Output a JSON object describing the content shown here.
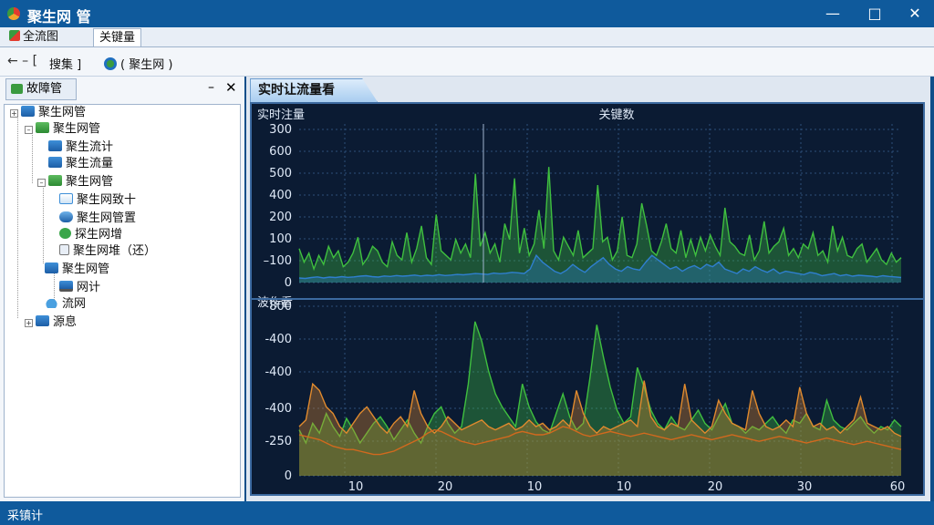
{
  "window": {
    "title": "聚生网 管"
  },
  "menu": {
    "tabs": [
      "全流图",
      "关键量"
    ]
  },
  "toolbar": {
    "back_label": "← – [",
    "breadcrumb_1": "搜集 ]",
    "breadcrumb_2": "( 聚生网 )"
  },
  "left_panel": {
    "header_button": "故障管",
    "pin": "–",
    "close": "✕",
    "tree": [
      {
        "label": "聚生网管",
        "icon": "folder-icon",
        "expander": "+"
      },
      {
        "label": "聚生网管",
        "icon": "green-folder-icon",
        "expander": "–"
      },
      {
        "label": "聚生流计",
        "icon": "folder-icon"
      },
      {
        "label": "聚生流量",
        "icon": "folder-icon"
      },
      {
        "label": "聚生网管",
        "icon": "green-folder-icon",
        "expander": "–"
      },
      {
        "label": "聚生网致十",
        "icon": "document-icon"
      },
      {
        "label": "聚生网管置",
        "icon": "database-icon"
      },
      {
        "label": "探生网增",
        "icon": "check-icon"
      },
      {
        "label": "聚生网堆（还）",
        "icon": "lock-icon"
      },
      {
        "label": "聚生网管",
        "icon": "folder-icon"
      },
      {
        "label": "网计",
        "icon": "monitor-icon"
      },
      {
        "label": "流网",
        "icon": "drop-icon"
      },
      {
        "label": "源息",
        "icon": "folder-icon",
        "expander": "+"
      }
    ]
  },
  "right_panel": {
    "tab_label": "实时让流量看"
  },
  "chart_data": [
    {
      "type": "area",
      "title": "实时注量",
      "subtitle": "关键数",
      "yticks": [
        0,
        100,
        200,
        300,
        400,
        500,
        600,
        300
      ],
      "ytick_labels": [
        "0",
        "–100",
        "100",
        "200",
        "400",
        "500",
        "600",
        "300"
      ],
      "ylim": [
        0,
        700
      ],
      "xlim": [
        5,
        60
      ],
      "series": [
        {
          "color": "#3fbf3f",
          "values": [
            150,
            90,
            130,
            60,
            120,
            80,
            160,
            110,
            140,
            70,
            90,
            130,
            200,
            80,
            110,
            160,
            140,
            90,
            70,
            180,
            120,
            100,
            220,
            90,
            150,
            250,
            110,
            80,
            300,
            140,
            120,
            100,
            190,
            130,
            170,
            110,
            480,
            160,
            220,
            130,
            170,
            90,
            260,
            190,
            460,
            130,
            240,
            120,
            170,
            320,
            150,
            510,
            140,
            100,
            200,
            160,
            120,
            230,
            110,
            130,
            150,
            430,
            180,
            200,
            100,
            140,
            290,
            120,
            110,
            170,
            350,
            250,
            140,
            120,
            180,
            260,
            150,
            130,
            230,
            110,
            190,
            120,
            200,
            140,
            210,
            160,
            120,
            330,
            180,
            160,
            130,
            120,
            210,
            100,
            140,
            270,
            130,
            160,
            180,
            240,
            120,
            150,
            110,
            170,
            150,
            220,
            120,
            140,
            90,
            250,
            140,
            200,
            120,
            110,
            150,
            170,
            90,
            120,
            150,
            100,
            80,
            130,
            90,
            110
          ]
        },
        {
          "color": "#2f7fcf",
          "values": [
            20,
            18,
            22,
            25,
            20,
            24,
            22,
            26,
            23,
            25,
            28,
            30,
            26,
            24,
            29,
            27,
            31,
            28,
            30,
            33,
            29,
            32,
            30,
            35,
            31,
            33,
            36,
            34,
            37,
            40,
            38,
            36,
            42,
            39,
            41,
            45,
            43,
            40,
            60,
            120,
            90,
            70,
            50,
            40,
            55,
            80,
            60,
            45,
            70,
            90,
            110,
            80,
            60,
            50,
            70,
            60,
            55,
            90,
            120,
            100,
            80,
            60,
            70,
            50,
            65,
            75,
            60,
            80,
            70,
            90,
            60,
            50,
            40,
            60,
            50,
            70,
            55,
            45,
            60,
            40,
            50,
            45,
            40,
            35,
            45,
            40,
            30,
            35,
            40,
            30,
            35,
            28,
            32,
            30,
            28,
            25,
            30,
            27,
            25,
            22
          ]
        }
      ]
    },
    {
      "type": "area",
      "title": "波作看",
      "yticks": [
        0,
        250,
        400,
        400,
        400,
        800
      ],
      "ytick_labels": [
        "0",
        "-250",
        "-400",
        "-400",
        "-400",
        "800"
      ],
      "ylim": [
        0,
        1000
      ],
      "xticks": [
        10,
        20,
        10,
        10,
        20,
        30,
        60
      ],
      "xlim": [
        5,
        60
      ],
      "series": [
        {
          "color": "#3fbf3f",
          "values": [
            280,
            200,
            320,
            260,
            380,
            300,
            240,
            350,
            280,
            200,
            260,
            320,
            360,
            300,
            220,
            280,
            340,
            260,
            200,
            300,
            380,
            420,
            320,
            260,
            300,
            560,
            940,
            820,
            640,
            500,
            420,
            360,
            300,
            560,
            420,
            330,
            280,
            260,
            380,
            500,
            360,
            280,
            320,
            600,
            920,
            720,
            540,
            400,
            320,
            360,
            660,
            540,
            400,
            320,
            280,
            360,
            300,
            280,
            340,
            400,
            320,
            280,
            360,
            440,
            320,
            300,
            260,
            300,
            280,
            320,
            360,
            300,
            260,
            340,
            320,
            380,
            300,
            280,
            460,
            340,
            300,
            280,
            320,
            360,
            300,
            260,
            300,
            280,
            340,
            300
          ]
        },
        {
          "color": "#e08a2e",
          "values": [
            300,
            340,
            560,
            520,
            420,
            380,
            300,
            260,
            320,
            380,
            420,
            360,
            300,
            260,
            320,
            360,
            300,
            520,
            380,
            300,
            260,
            300,
            360,
            320,
            280,
            300,
            320,
            340,
            300,
            280,
            300,
            320,
            280,
            300,
            340,
            300,
            320,
            280,
            300,
            340,
            300,
            520,
            380,
            300,
            260,
            300,
            280,
            300,
            320,
            340,
            300,
            580,
            360,
            300,
            280,
            320,
            300,
            560,
            340,
            300,
            260,
            300,
            460,
            380,
            320,
            300,
            280,
            520,
            380,
            300,
            280,
            300,
            340,
            300,
            540,
            380,
            300,
            320,
            280,
            300,
            260,
            300,
            340,
            480,
            320,
            300,
            280,
            300,
            260,
            240
          ]
        },
        {
          "color": "#d2691e",
          "values": [
            250,
            240,
            230,
            220,
            200,
            180,
            170,
            160,
            160,
            150,
            140,
            130,
            130,
            140,
            150,
            170,
            190,
            210,
            230,
            260,
            280,
            270,
            250,
            230,
            210,
            200,
            190,
            200,
            210,
            220,
            230,
            240,
            260,
            270,
            260,
            250,
            250,
            260,
            280,
            300,
            290,
            270,
            250,
            240,
            250,
            260,
            270,
            260,
            250,
            240,
            250,
            260,
            250,
            240,
            230,
            220,
            230,
            240,
            250,
            240,
            230,
            220,
            230,
            240,
            250,
            240,
            230,
            220,
            210,
            220,
            230,
            240,
            230,
            220,
            210,
            200,
            210,
            220,
            230,
            220,
            210,
            200,
            190,
            200,
            210,
            200,
            190,
            180,
            170,
            160
          ]
        }
      ]
    }
  ],
  "status": {
    "text": "采镇计"
  }
}
